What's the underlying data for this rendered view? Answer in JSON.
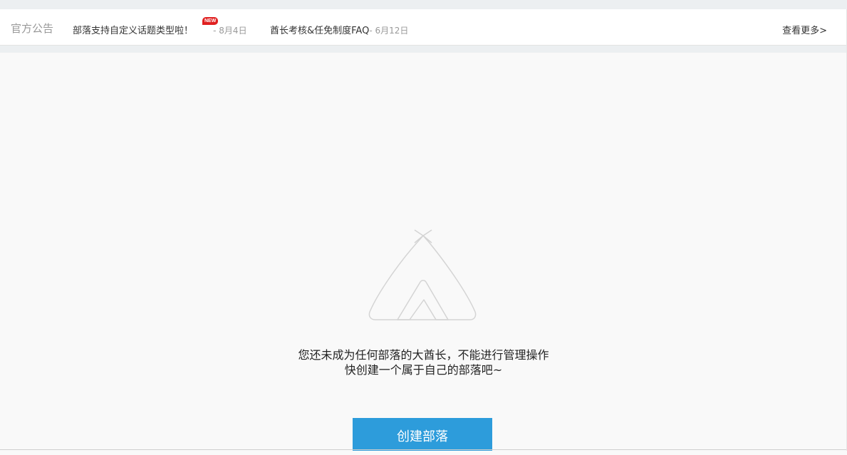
{
  "notice": {
    "title": "官方公告",
    "items": [
      {
        "text": "部落支持自定义话题类型啦！",
        "badge": "NEW",
        "date": "- 8月4日"
      },
      {
        "text": "酋长考核&任免制度FAQ",
        "date": "- 6月12日"
      }
    ],
    "more_label": "查看更多>"
  },
  "empty_state": {
    "icon": "tent-icon",
    "line1": "您还未成为任何部落的大酋长，不能进行管理操作",
    "line2": "快创建一个属于自己的部落吧~",
    "button_label": "创建部落"
  },
  "colors": {
    "accent": "#2d9cdb",
    "badge": "#e02020"
  }
}
